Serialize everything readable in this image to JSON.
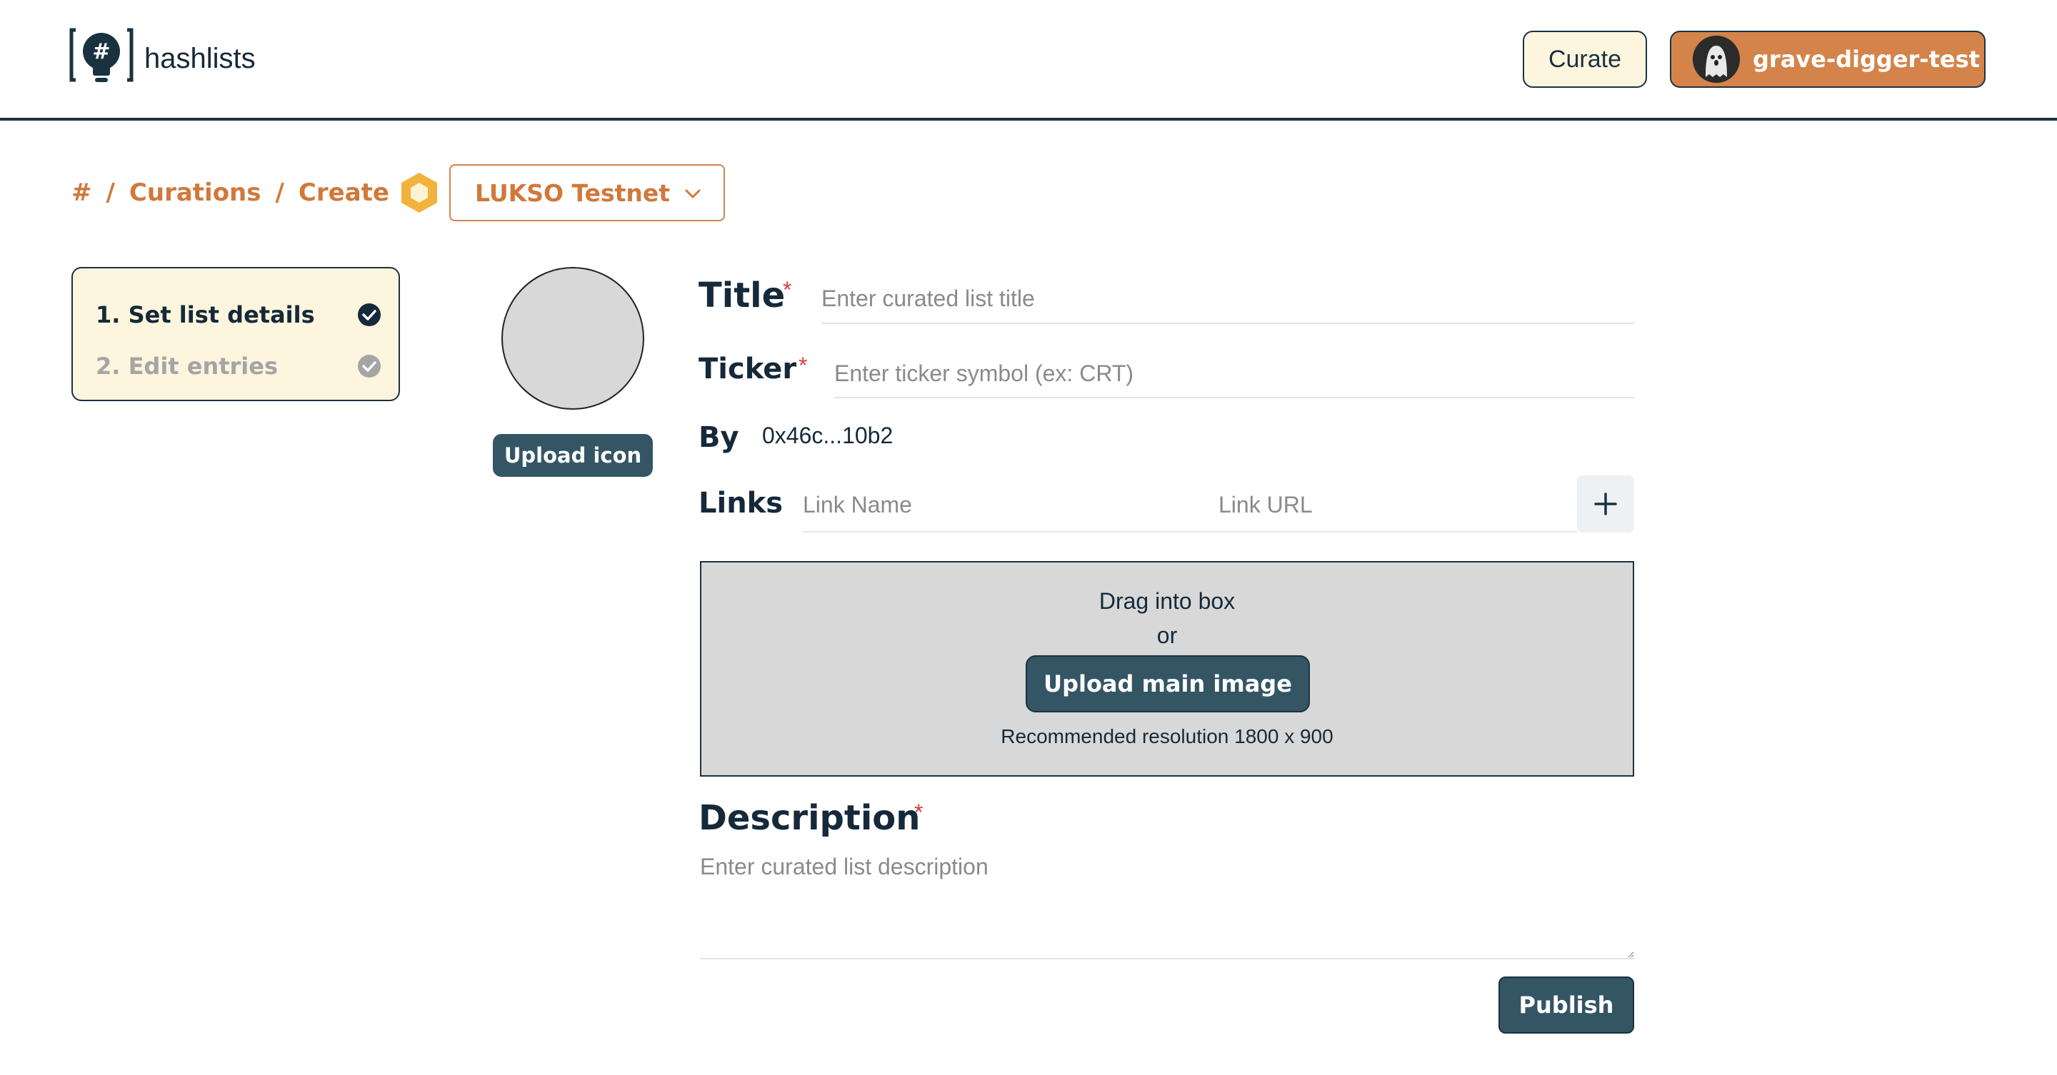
{
  "app": {
    "name": "hashlists",
    "logo_glyph": "#"
  },
  "header": {
    "curate_label": "Curate",
    "user_name": "grave-digger-test"
  },
  "breadcrumb": {
    "home": "#",
    "separator": "/",
    "curations": "Curations",
    "create": "Create",
    "network": "LUKSO Testnet"
  },
  "steps": [
    {
      "label": "1. Set list details",
      "state": "active"
    },
    {
      "label": "2. Edit entries",
      "state": "inactive"
    }
  ],
  "icon_upload": {
    "button_label": "Upload icon"
  },
  "form": {
    "title_label": "Title",
    "title_placeholder": "Enter curated list title",
    "ticker_label": "Ticker",
    "ticker_placeholder": "Enter ticker symbol (ex: CRT)",
    "by_label": "By",
    "by_value": "0x46c...10b2",
    "links_label": "Links",
    "link_name_placeholder": "Link Name",
    "link_url_placeholder": "Link URL",
    "required_mark": "*",
    "description_label": "Description",
    "description_placeholder": "Enter curated list description"
  },
  "dropzone": {
    "line1": "Drag into box",
    "line2": "or",
    "button_label": "Upload main image",
    "recommendation": "Recommended resolution 1800 x 900"
  },
  "actions": {
    "publish_label": "Publish"
  },
  "colors": {
    "accent_orange": "#d0793b",
    "dark_teal": "#345664",
    "navy": "#15293a",
    "cream": "#fdf5dd",
    "required_red": "#d0413a"
  },
  "icons": {
    "logo": "lightbulb-hash-icon",
    "chain": "lukso-hexagon-icon",
    "dropdown": "chevron-down-icon",
    "step_done": "check-circle-icon",
    "add_link": "plus-icon"
  }
}
